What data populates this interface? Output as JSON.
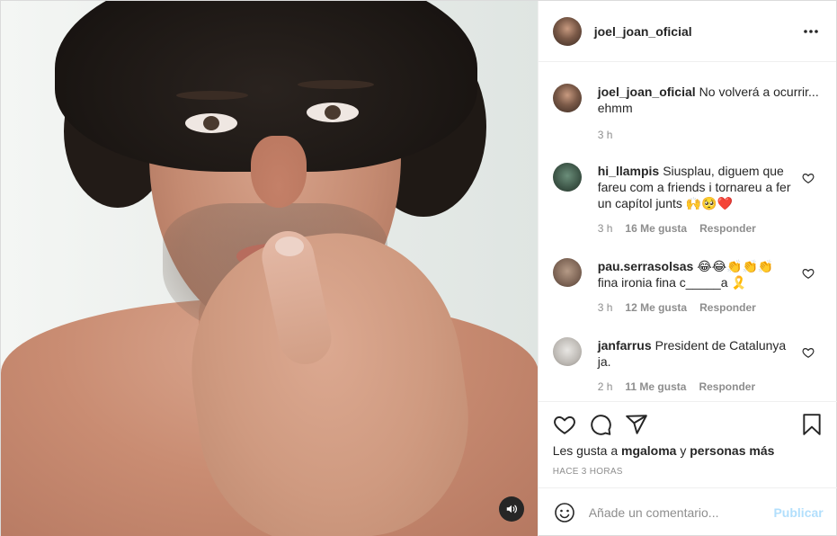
{
  "post": {
    "username": "joel_joan_oficial",
    "caption": "No volverá a ocurrir... ehmm",
    "caption_time": "3 h"
  },
  "comments": [
    {
      "username": "hi_llampis",
      "text": "Siusplau, diguem que fareu com a friends i tornareu a fer un capítol junts 🙌🥺❤️",
      "time": "3 h",
      "likes": "16 Me gusta",
      "reply": "Responder"
    },
    {
      "username": "pau.serrasolsas",
      "text": "😂😂👏👏👏 fina ironia fina c_____a 🎗️",
      "time": "3 h",
      "likes": "12 Me gusta",
      "reply": "Responder"
    },
    {
      "username": "janfarrus",
      "text": "President de Catalunya ja.",
      "time": "2 h",
      "likes": "11 Me gusta",
      "reply": "Responder"
    }
  ],
  "likes": {
    "prefix": "Les gusta a",
    "user": "mgaloma",
    "connector": "y",
    "others": "personas más"
  },
  "timestamp": "HACE 3 HORAS",
  "composer": {
    "placeholder": "Añade un comentario...",
    "post_label": "Publicar"
  },
  "icons": [
    "more-icon",
    "heart-icon",
    "comment-icon",
    "share-icon",
    "bookmark-icon",
    "emoji-icon",
    "audio-icon"
  ]
}
